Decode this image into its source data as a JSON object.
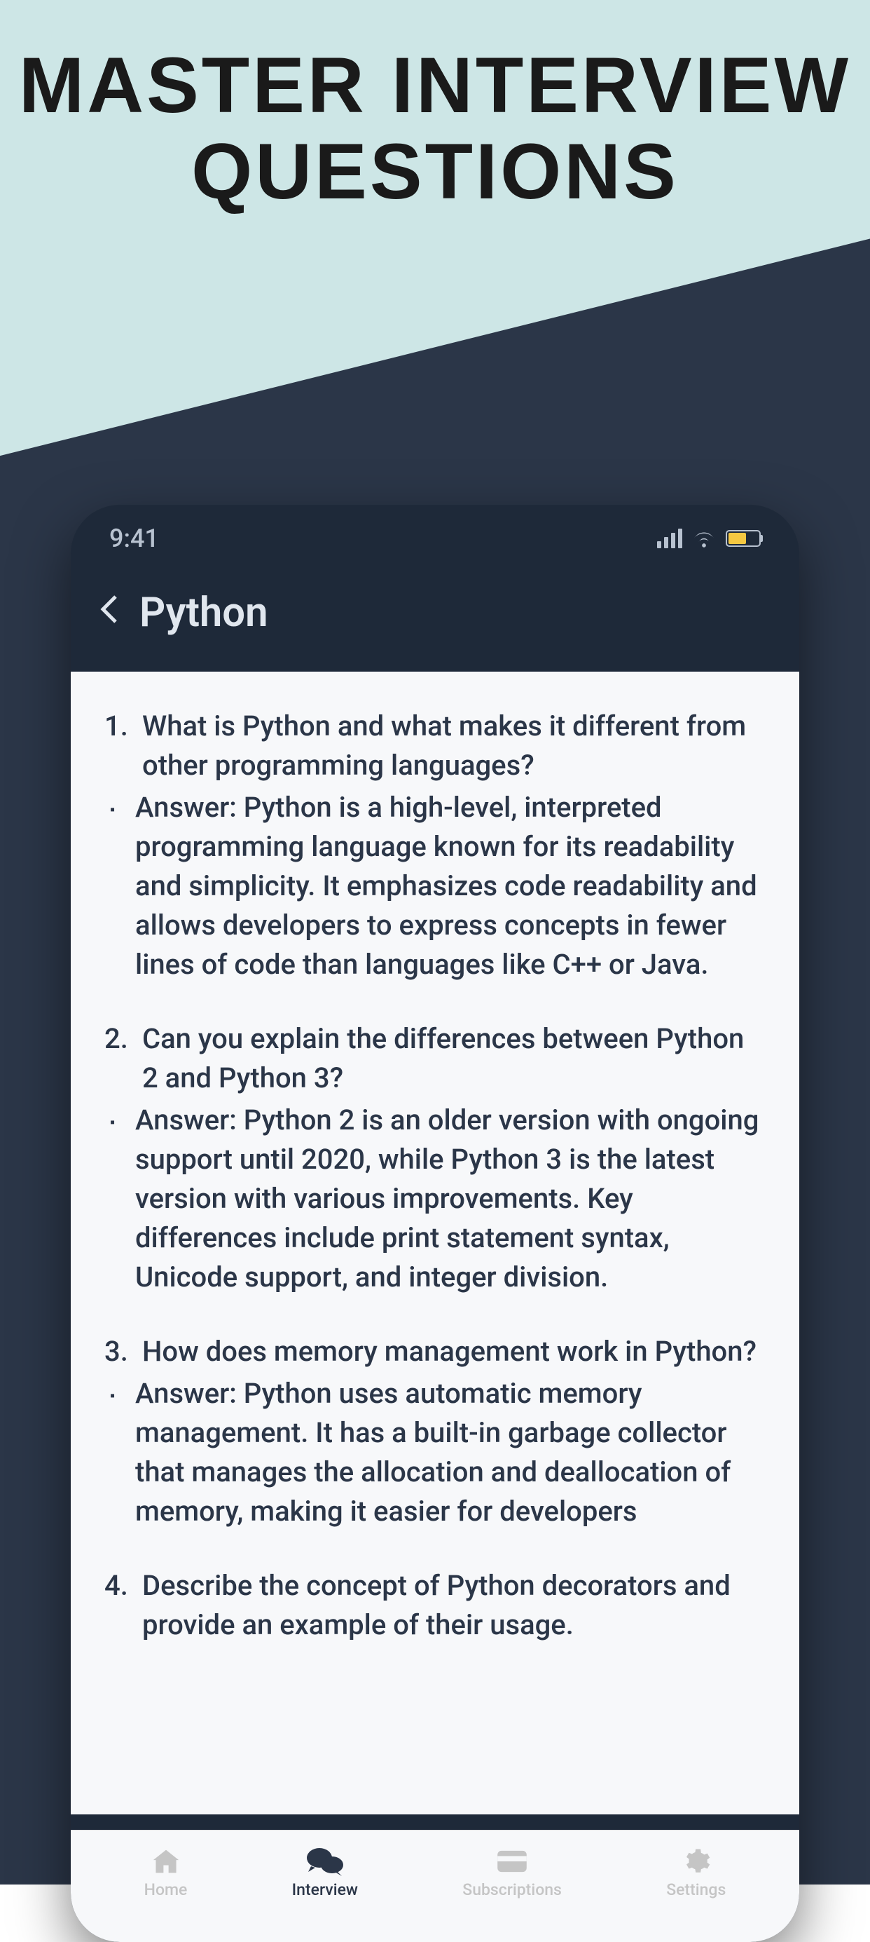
{
  "promo": {
    "title_line1": "MASTER INTERVIEW",
    "title_line2": "QUESTIONS"
  },
  "statusBar": {
    "time": "9:41"
  },
  "header": {
    "title": "Python"
  },
  "questions": [
    {
      "number": "1.",
      "question": "What is Python and what makes it different from other programming languages?",
      "answer": "Answer: Python is a high-level, interpreted programming language known for its readability and simplicity. It emphasizes code readability and allows developers to express concepts in fewer lines of code than languages like C++ or Java."
    },
    {
      "number": "2.",
      "question": "Can you explain the differences between Python 2 and Python 3?",
      "answer": "Answer: Python 2 is an older version with ongoing support until 2020, while Python 3 is the latest version with various improvements. Key differences include print statement syntax, Unicode support, and integer division."
    },
    {
      "number": "3.",
      "question": "How does memory management work in Python?",
      "answer": "Answer: Python uses automatic memory management. It has a built-in garbage collector that manages the allocation and deallocation of memory, making it easier for developers"
    },
    {
      "number": "4.",
      "question": "Describe the concept of Python decorators and provide an example of their usage.",
      "answer": ""
    }
  ],
  "nav": {
    "home": "Home",
    "interview": "Interview",
    "subscriptions": "Subscriptions",
    "settings": "Settings"
  }
}
